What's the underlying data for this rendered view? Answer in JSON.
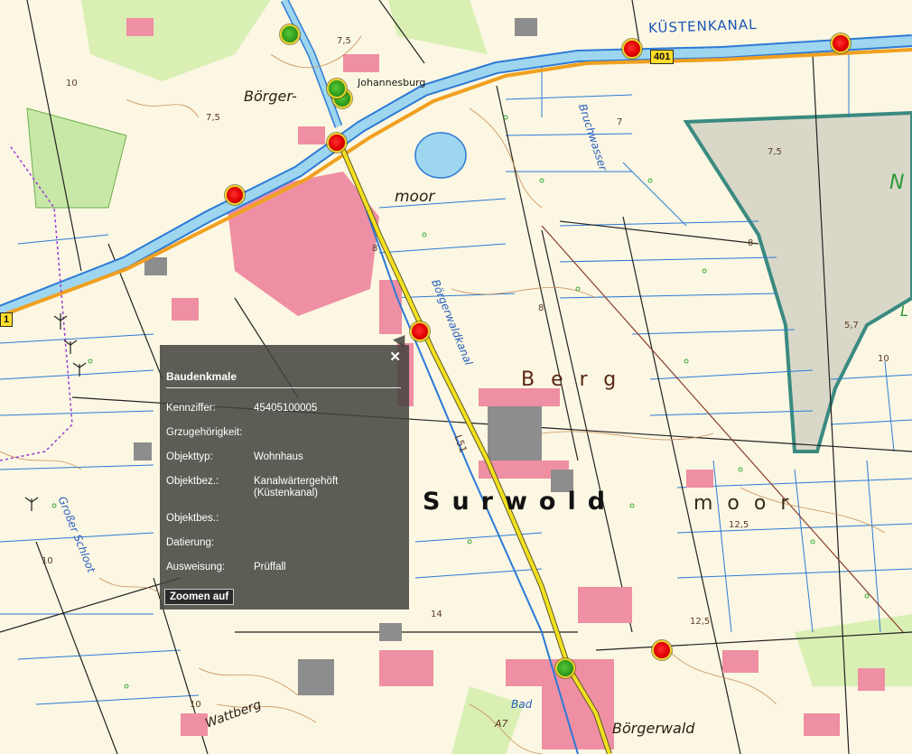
{
  "map": {
    "place_labels": {
      "boerger": "Börger-",
      "johannesburg": "Johannesburg",
      "moor": "moor",
      "kuestenkanal": "KÜSTENKANAL",
      "bruchwasser": "Bruchwasser",
      "boergerwaldkanal": "Börgerwaldkanal",
      "berg": "Berg",
      "surwold": "Surwold",
      "moor_large": "moor",
      "grosser_schloot": "Großer Schloot",
      "wattberg": "Wattberg",
      "boergerwald": "Börgerwald",
      "bad": "Bad",
      "n_partial": "N",
      "l_partial": "L"
    },
    "road_shields": {
      "b401": "401",
      "l51": "L51",
      "edge": "1",
      "a7": "A7"
    },
    "contour_values": [
      "10",
      "7,5",
      "7",
      "8",
      "7,5",
      "7,5",
      "8",
      "8",
      "5,7",
      "10",
      "10",
      "12,5",
      "14",
      "10",
      "12,5"
    ],
    "colors": {
      "background": "#fbf7e2",
      "settlement": "#ef8fa3",
      "water": "#2c7ad6",
      "canal": "#8fd0ea",
      "road_yellow": "#f5e020",
      "road_orange": "#f0a020",
      "marker_red": "#e00000",
      "marker_green": "#2e9a1c",
      "marker_ring": "#e9d12a",
      "reserve_fill": "#d6d4c4",
      "reserve_border": "#3a8a80"
    }
  },
  "popup": {
    "title": "Baudenkmale",
    "close_icon": "close-icon",
    "rows": [
      {
        "key": "Kennziffer:",
        "value": "45405100005"
      },
      {
        "key": "Grzugehörigkeit:",
        "value": ""
      },
      {
        "key": "Objekttyp:",
        "value": "Wohnhaus"
      },
      {
        "key": "Objektbez.:",
        "value": "Kanalwärtergehöft (Küstenkanal)"
      },
      {
        "key": "Objektbes.:",
        "value": ""
      },
      {
        "key": "Datierung:",
        "value": ""
      },
      {
        "key": "Ausweisung:",
        "value": "Prüffall"
      }
    ],
    "zoom_label": "Zoomen auf"
  }
}
